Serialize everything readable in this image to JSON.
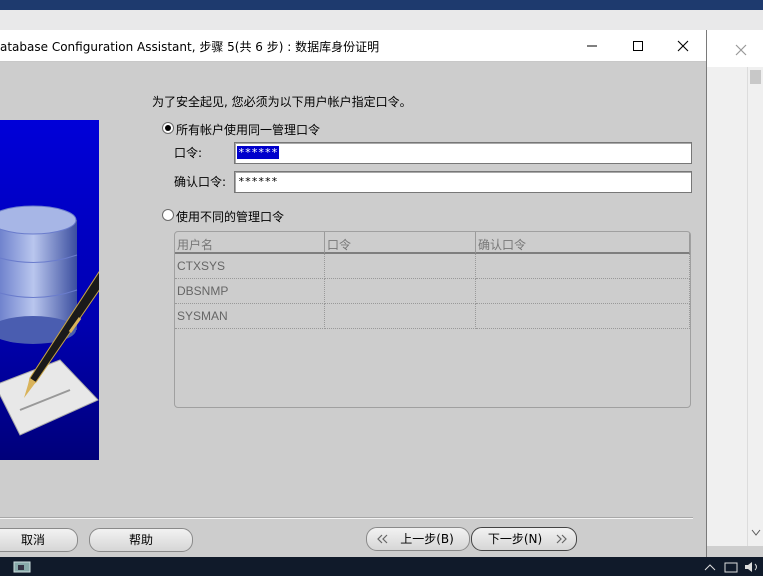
{
  "window": {
    "title": "atabase Configuration Assistant, 步骤 5(共 6 步) : 数据库身份证明"
  },
  "instruction": "为了安全起见, 您必须为以下用户帐户指定口令。",
  "same_password_option": {
    "label": "所有帐户使用同一管理口令",
    "selected": true,
    "password_label": "口令:",
    "password_value": "******",
    "confirm_label": "确认口令:",
    "confirm_value": "******"
  },
  "different_password_option": {
    "label": "使用不同的管理口令",
    "selected": false
  },
  "accounts_table": {
    "columns": [
      "用户名",
      "口令",
      "确认口令"
    ],
    "rows": [
      [
        "CTXSYS",
        "",
        ""
      ],
      [
        "DBSNMP",
        "",
        ""
      ],
      [
        "SYSMAN",
        "",
        ""
      ]
    ]
  },
  "buttons": {
    "cancel": "取消",
    "help": "帮助",
    "back": "上一步(B)",
    "next": "下一步(N)"
  },
  "colors": {
    "illustration_blue": "#0000d8",
    "selection_blue": "#0000cc"
  }
}
